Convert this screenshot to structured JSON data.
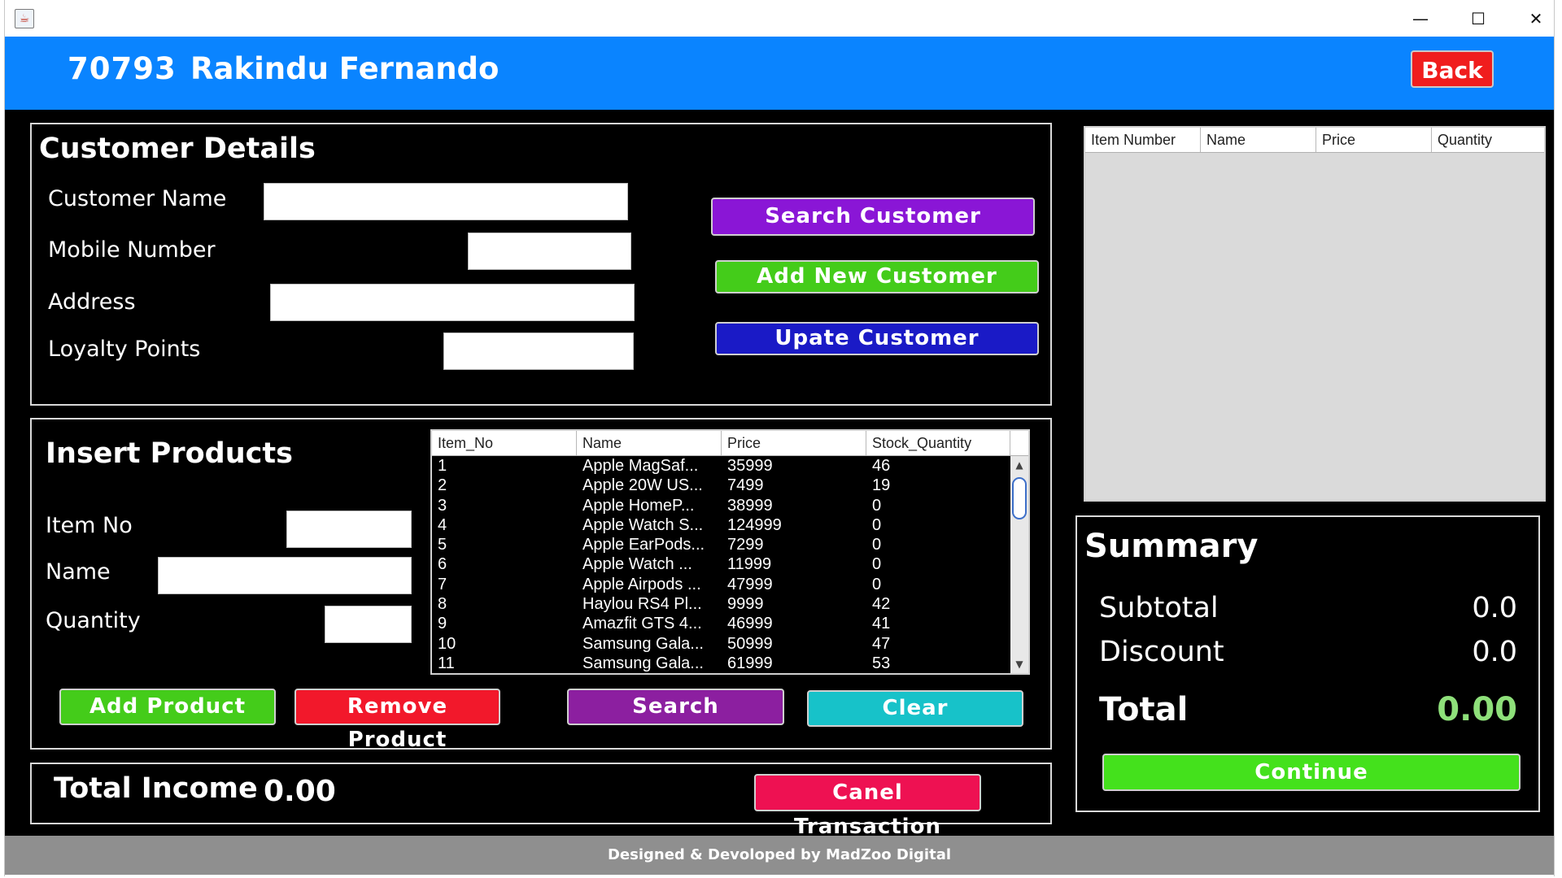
{
  "window": {
    "icon": "java-app-icon",
    "controls": {
      "minimize": "—",
      "maximize": "☐",
      "close": "✕"
    }
  },
  "header": {
    "user_id": "70793",
    "user_name": "Rakindu Fernando",
    "back_label": "Back",
    "bg_color": "#0a84ff"
  },
  "customer": {
    "title": "Customer Details",
    "name_label": "Customer Name",
    "mobile_label": "Mobile Number",
    "address_label": "Address",
    "loyalty_label": "Loyalty Points",
    "name_value": "",
    "mobile_value": "",
    "address_value": "",
    "loyalty_value": "",
    "search_btn": "Search Customer",
    "add_btn": "Add New Customer",
    "update_btn": "Upate Customer"
  },
  "products": {
    "title": "Insert Products",
    "item_no_label": "Item No",
    "name_label": "Name",
    "quantity_label": "Quantity",
    "item_no_value": "",
    "name_value": "",
    "quantity_value": "",
    "add_btn": "Add Product",
    "remove_btn": "Remove Product",
    "search_btn": "Search",
    "clear_btn": "Clear",
    "table": {
      "columns": [
        "Item_No",
        "Name",
        "Price",
        "Stock_Quantity"
      ],
      "rows": [
        [
          "1",
          "Apple MagSaf...",
          "35999",
          "46"
        ],
        [
          "2",
          "Apple 20W US...",
          "7499",
          "19"
        ],
        [
          "3",
          "Apple HomeP...",
          "38999",
          "0"
        ],
        [
          "4",
          "Apple Watch S...",
          "124999",
          "0"
        ],
        [
          "5",
          "Apple EarPods...",
          "7299",
          "0"
        ],
        [
          "6",
          "Apple Watch ...",
          "11999",
          "0"
        ],
        [
          "7",
          "Apple Airpods ...",
          "47999",
          "0"
        ],
        [
          "8",
          "Haylou RS4 Pl...",
          "9999",
          "42"
        ],
        [
          "9",
          "Amazfit GTS 4...",
          "46999",
          "41"
        ],
        [
          "10",
          "Samsung Gala...",
          "50999",
          "47"
        ],
        [
          "11",
          "Samsung Gala...",
          "61999",
          "53"
        ]
      ]
    }
  },
  "income": {
    "label": "Total Income",
    "value": "0.00",
    "cancel_btn": "Canel Transaction"
  },
  "cart": {
    "columns": [
      "Item Number",
      "Name",
      "Price",
      "Quantity"
    ],
    "rows": []
  },
  "summary": {
    "title": "Summary",
    "subtotal_label": "Subtotal",
    "subtotal_value": "0.0",
    "discount_label": "Discount",
    "discount_value": "0.0",
    "total_label": "Total",
    "total_value": "0.00",
    "total_color": "#8ee07a",
    "continue_btn": "Continue"
  },
  "footer": {
    "text": "Designed & Devoloped by MadZoo Digital"
  }
}
